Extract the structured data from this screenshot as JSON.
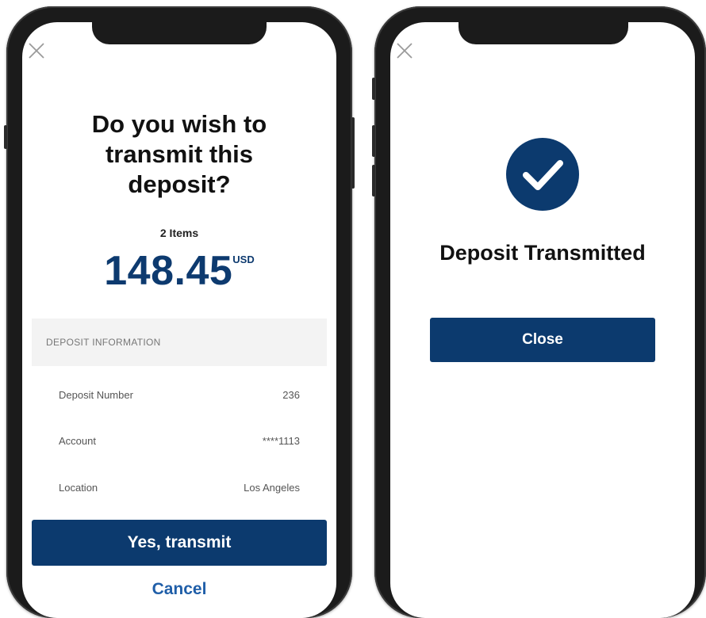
{
  "confirm_screen": {
    "title_line1": "Do you wish to",
    "title_line2": "transmit this",
    "title_line3": "deposit?",
    "items_count": "2 Items",
    "amount": "148.45",
    "currency": "USD",
    "section_header": "DEPOSIT INFORMATION",
    "rows": [
      {
        "label": "Deposit Number",
        "value": "236"
      },
      {
        "label": "Account",
        "value": "****1113"
      },
      {
        "label": "Location",
        "value": "Los Angeles"
      }
    ],
    "primary_button": "Yes, transmit",
    "cancel_link": "Cancel"
  },
  "success_screen": {
    "title": "Deposit Transmitted",
    "close_button": "Close"
  },
  "icons": {
    "close": "close-icon",
    "check": "check-circle-icon"
  },
  "colors": {
    "primary": "#0c3a6e",
    "link": "#1f5ea8",
    "section_bg": "#f3f3f3"
  }
}
